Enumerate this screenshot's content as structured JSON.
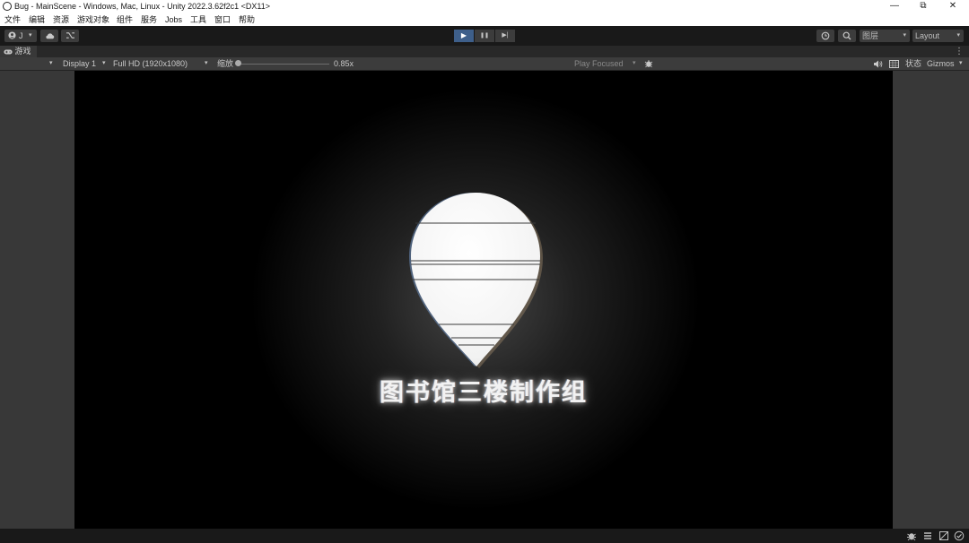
{
  "window": {
    "title": "Bug - MainScene - Windows, Mac, Linux - Unity 2022.3.62f2c1 <DX11>",
    "controls": {
      "minimize": "—",
      "maximize": "⧉",
      "close": "✕"
    }
  },
  "menu": [
    "文件",
    "编辑",
    "资源",
    "游戏对象",
    "组件",
    "服务",
    "Jobs",
    "工具",
    "窗口",
    "帮助"
  ],
  "toolbar": {
    "account_label": "J",
    "play_icon": "▶",
    "pause_icon": "❚❚",
    "step_icon": "▶|",
    "layers_label": "图层",
    "layout_label": "Layout",
    "caret": "▾"
  },
  "game_tab": {
    "label": "游戏",
    "more_icon": "⋮"
  },
  "game_toolbar": {
    "display": "Display 1",
    "resolution": "Full HD (1920x1080)",
    "scale_label": "缩放",
    "scale_value": "0.85x",
    "play_mode": "Play Focused",
    "stats_label": "状态",
    "gizmos_label": "Gizmos",
    "caret": "▾"
  },
  "game_view": {
    "logo_text": "图书馆三楼制作组",
    "logo_icon": "map-pin-icon"
  },
  "colors": {
    "editor_bg": "#383838",
    "toolbar_bg": "#191919",
    "play_active": "#3e5f8a",
    "game_bg": "#000000",
    "logo_white": "#f4f4f4"
  }
}
